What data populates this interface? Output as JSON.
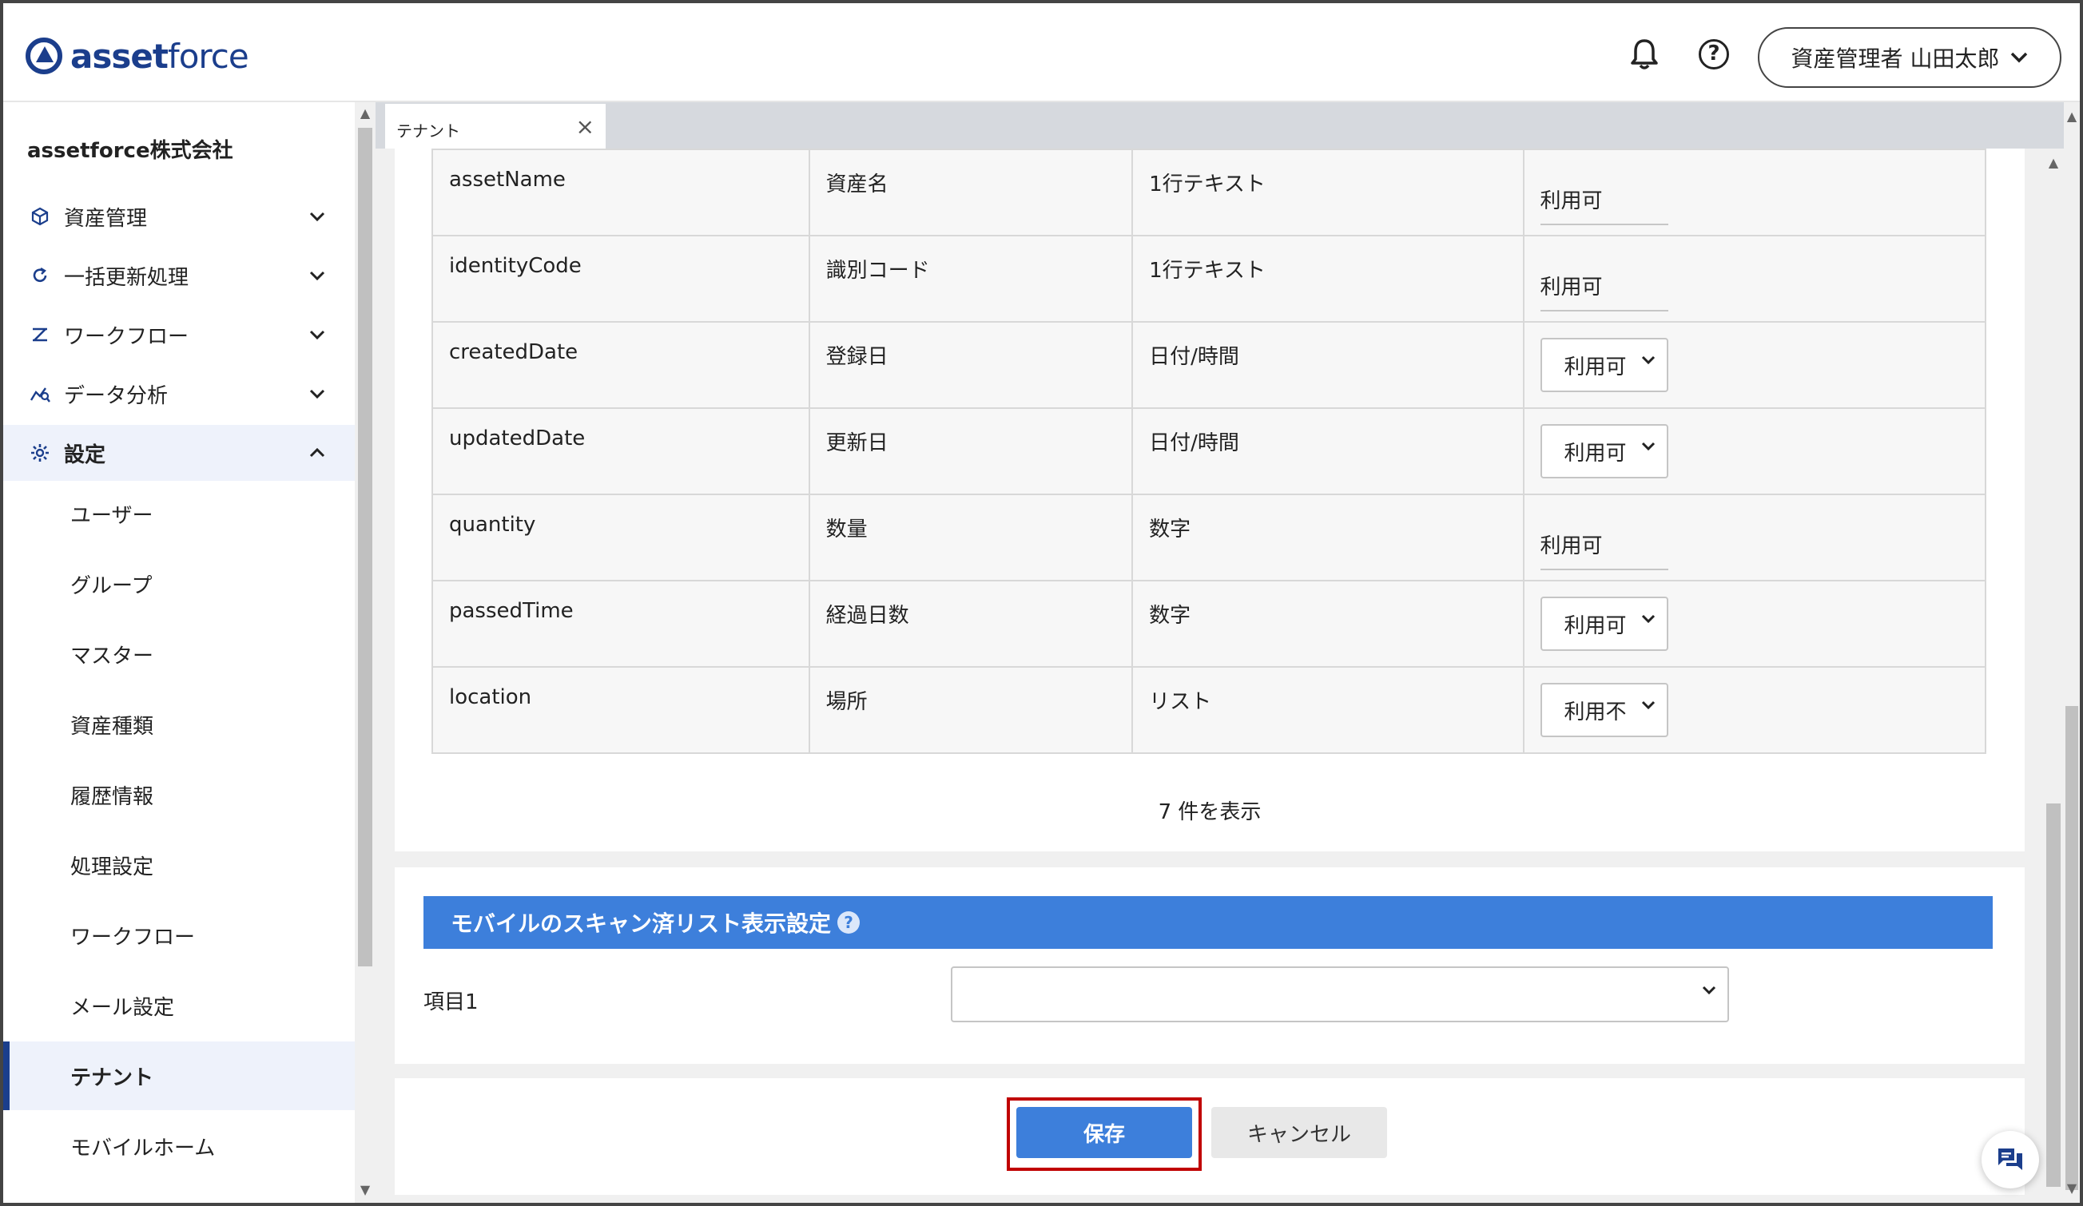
{
  "header": {
    "logo_text_bold": "asset",
    "logo_text_light": "force",
    "user_label": "資産管理者 山田太郎",
    "icons": [
      "bell-icon",
      "help-icon",
      "chevron-down-icon"
    ]
  },
  "sidebar": {
    "company": "assetforce株式会社",
    "nav": [
      {
        "label": "資産管理",
        "icon": "cube-icon",
        "expanded": false
      },
      {
        "label": "一括更新処理",
        "icon": "refresh-icon",
        "expanded": false
      },
      {
        "label": "ワークフロー",
        "icon": "workflow-icon",
        "expanded": false
      },
      {
        "label": "データ分析",
        "icon": "analytics-icon",
        "expanded": false
      },
      {
        "label": "設定",
        "icon": "gear-icon",
        "expanded": true
      }
    ],
    "sub_items": [
      "ユーザー",
      "グループ",
      "マスター",
      "資産種類",
      "履歴情報",
      "処理設定",
      "ワークフロー",
      "メール設定",
      "テナント",
      "モバイルホーム"
    ],
    "selected_sub": "テナント"
  },
  "tab": {
    "label": "テナント"
  },
  "fields_table": {
    "rows": [
      {
        "key": "assetName",
        "name": "資産名",
        "type": "1行テキスト",
        "status": "利用可",
        "editable": false
      },
      {
        "key": "identityCode",
        "name": "識別コード",
        "type": "1行テキスト",
        "status": "利用可",
        "editable": false
      },
      {
        "key": "createdDate",
        "name": "登録日",
        "type": "日付/時間",
        "status": "利用可",
        "editable": true
      },
      {
        "key": "updatedDate",
        "name": "更新日",
        "type": "日付/時間",
        "status": "利用可",
        "editable": true
      },
      {
        "key": "quantity",
        "name": "数量",
        "type": "数字",
        "status": "利用可",
        "editable": false
      },
      {
        "key": "passedTime",
        "name": "経過日数",
        "type": "数字",
        "status": "利用可",
        "editable": true
      },
      {
        "key": "location",
        "name": "場所",
        "type": "リスト",
        "status": "利用不",
        "editable": true
      }
    ],
    "count_label": "7 件を表示"
  },
  "mobile_section": {
    "title": "モバイルのスキャン済リスト表示設定",
    "help_glyph": "?",
    "item_label": "項目1",
    "item_value": ""
  },
  "actions": {
    "save_label": "保存",
    "cancel_label": "キャンセル",
    "highlight_color": "#c00000",
    "accent_color": "#3d7fdb"
  }
}
